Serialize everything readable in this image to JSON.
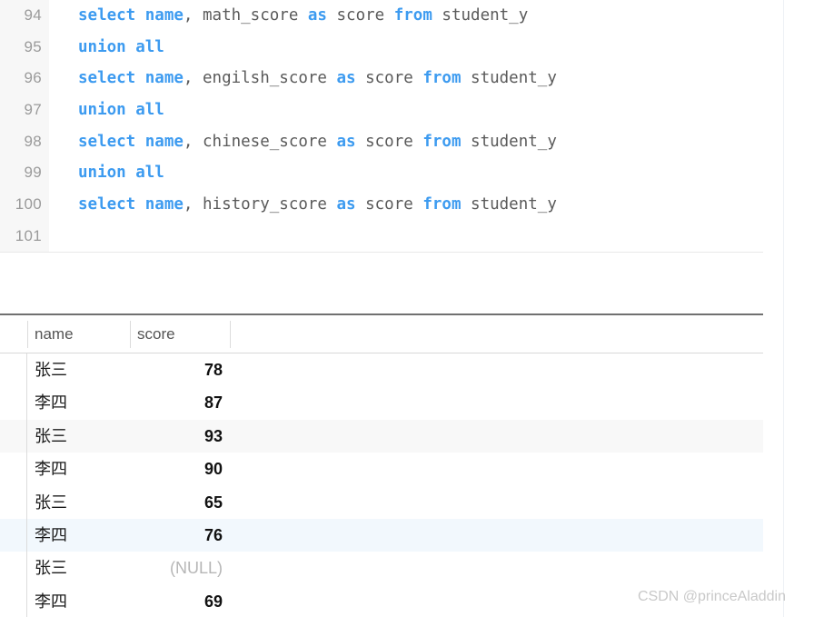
{
  "editor": {
    "language": "sql",
    "keyword_color": "#3d9bf0",
    "text_color": "#5a5a5a",
    "lines": [
      {
        "number": "94",
        "tokens": [
          {
            "t": "select",
            "kw": true
          },
          {
            "t": " ",
            "kw": false
          },
          {
            "t": "name",
            "kw": true
          },
          {
            "t": ", math_score ",
            "kw": false
          },
          {
            "t": "as",
            "kw": true
          },
          {
            "t": " score ",
            "kw": false
          },
          {
            "t": "from",
            "kw": true
          },
          {
            "t": " student_y",
            "kw": false
          }
        ]
      },
      {
        "number": "95",
        "tokens": [
          {
            "t": "union all",
            "kw": true
          }
        ]
      },
      {
        "number": "96",
        "tokens": [
          {
            "t": "select",
            "kw": true
          },
          {
            "t": " ",
            "kw": false
          },
          {
            "t": "name",
            "kw": true
          },
          {
            "t": ", engilsh_score ",
            "kw": false
          },
          {
            "t": "as",
            "kw": true
          },
          {
            "t": " score ",
            "kw": false
          },
          {
            "t": "from",
            "kw": true
          },
          {
            "t": " student_y",
            "kw": false
          }
        ]
      },
      {
        "number": "97",
        "tokens": [
          {
            "t": "union all",
            "kw": true
          }
        ]
      },
      {
        "number": "98",
        "tokens": [
          {
            "t": "select",
            "kw": true
          },
          {
            "t": " ",
            "kw": false
          },
          {
            "t": "name",
            "kw": true
          },
          {
            "t": ", chinese_score ",
            "kw": false
          },
          {
            "t": "as",
            "kw": true
          },
          {
            "t": " score ",
            "kw": false
          },
          {
            "t": "from",
            "kw": true
          },
          {
            "t": " student_y",
            "kw": false
          }
        ]
      },
      {
        "number": "99",
        "tokens": [
          {
            "t": "union all",
            "kw": true
          }
        ]
      },
      {
        "number": "100",
        "tokens": [
          {
            "t": "select",
            "kw": true
          },
          {
            "t": " ",
            "kw": false
          },
          {
            "t": "name",
            "kw": true
          },
          {
            "t": ", history_score ",
            "kw": false
          },
          {
            "t": "as",
            "kw": true
          },
          {
            "t": " score ",
            "kw": false
          },
          {
            "t": "from",
            "kw": true
          },
          {
            "t": " student_y",
            "kw": false
          }
        ]
      },
      {
        "number": "101",
        "tokens": []
      }
    ]
  },
  "result_grid": {
    "columns": [
      "name",
      "score"
    ],
    "rows": [
      {
        "name": "张三",
        "score": "78",
        "null": false,
        "striped": false,
        "selected": false
      },
      {
        "name": "李四",
        "score": "87",
        "null": false,
        "striped": false,
        "selected": false
      },
      {
        "name": "张三",
        "score": "93",
        "null": false,
        "striped": true,
        "selected": false
      },
      {
        "name": "李四",
        "score": "90",
        "null": false,
        "striped": false,
        "selected": false
      },
      {
        "name": "张三",
        "score": "65",
        "null": false,
        "striped": false,
        "selected": false
      },
      {
        "name": "李四",
        "score": "76",
        "null": false,
        "striped": false,
        "selected": true
      },
      {
        "name": "张三",
        "score": "(NULL)",
        "null": true,
        "striped": false,
        "selected": false
      },
      {
        "name": "李四",
        "score": "69",
        "null": false,
        "striped": false,
        "selected": false
      }
    ]
  },
  "watermark": {
    "text": "CSDN @princeAladdin"
  }
}
